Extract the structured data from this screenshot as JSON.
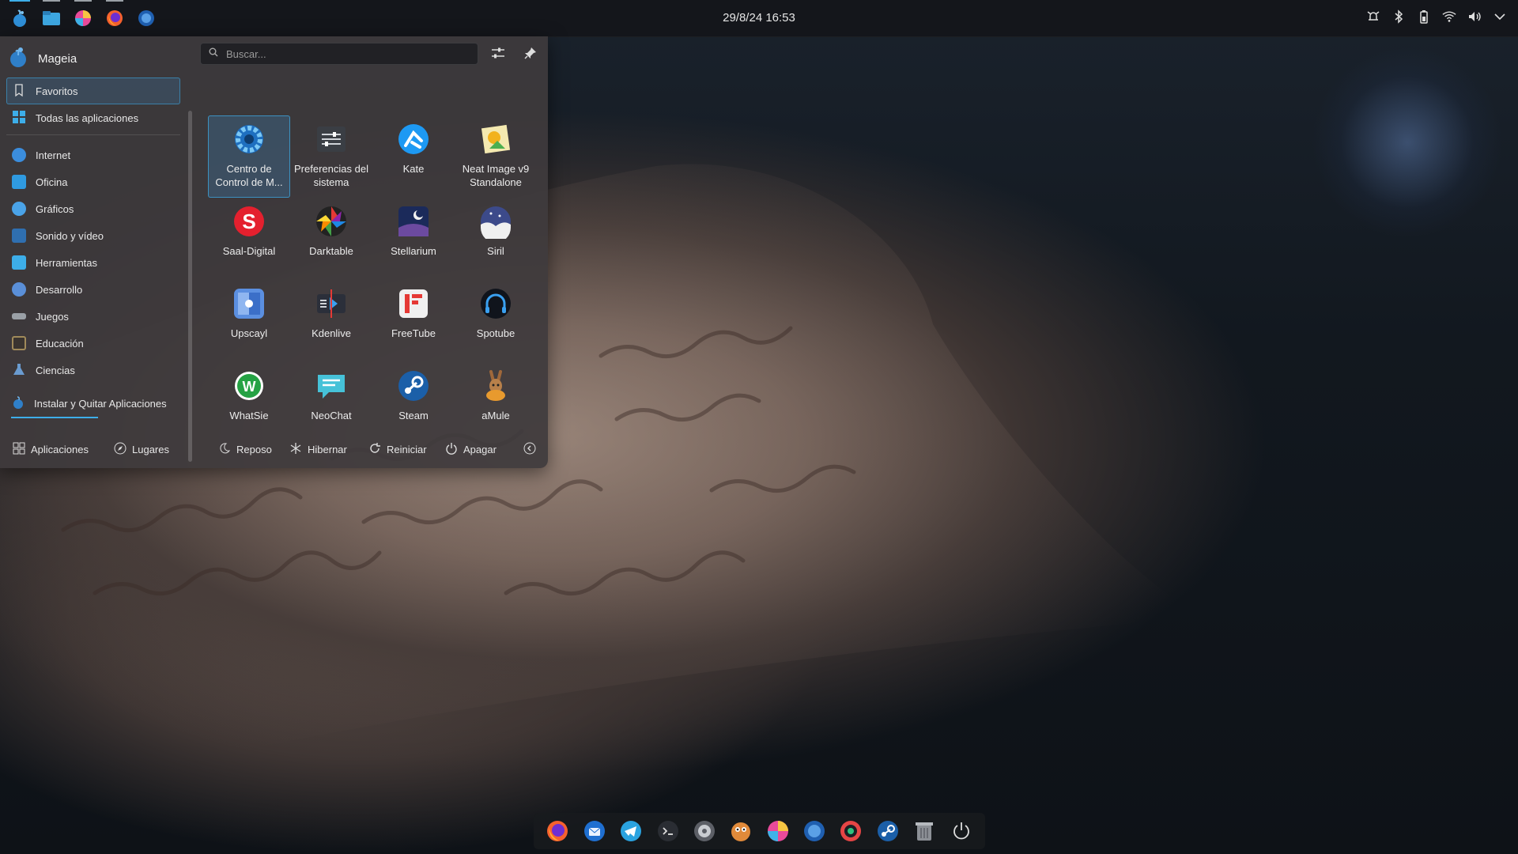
{
  "top_panel": {
    "clock": "29/8/24 16:53",
    "launchers": [
      {
        "icon": "mageia-menu-icon"
      },
      {
        "icon": "file-manager-icon"
      },
      {
        "icon": "krita-icon"
      },
      {
        "icon": "firefox-icon"
      },
      {
        "icon": "blue-globe-icon"
      }
    ],
    "tray": [
      "notifications-icon",
      "bluetooth-icon",
      "battery-icon",
      "wifi-icon",
      "volume-icon",
      "chevron-down-icon"
    ]
  },
  "menu": {
    "user": "Mageia",
    "search": {
      "placeholder": "Buscar..."
    },
    "categories": [
      {
        "label": "Favoritos",
        "color": "#3d3d44"
      },
      {
        "label": "Todas las aplicaciones",
        "color": "#3daee9"
      }
    ],
    "sections": [
      {
        "label": "Internet",
        "color": "#3b8ddd"
      },
      {
        "label": "Oficina",
        "color": "#2f9ae0"
      },
      {
        "label": "Gráficos",
        "color": "#4aa3e8"
      },
      {
        "label": "Sonido y vídeo",
        "color": "#2f6fb0"
      },
      {
        "label": "Herramientas",
        "color": "#3daee9"
      },
      {
        "label": "Desarrollo",
        "color": "#5a8fd8"
      },
      {
        "label": "Juegos",
        "color": "#9aa0a6"
      },
      {
        "label": "Educación",
        "color": "#a08a5a"
      },
      {
        "label": "Ciencias",
        "color": "#6a9bd0"
      }
    ],
    "installer": {
      "label": "Instalar y Quitar Aplicaciones"
    },
    "apps": [
      {
        "label": "Centro de Control de M...",
        "icon": "control-center-gear-icon"
      },
      {
        "label": "Preferencias del sistema",
        "icon": "system-settings-icon"
      },
      {
        "label": "Kate",
        "icon": "kate-icon"
      },
      {
        "label": "Neat Image v9 Standalone",
        "icon": "neat-image-icon"
      },
      {
        "label": "Saal-Digital",
        "icon": "saal-digital-icon"
      },
      {
        "label": "Darktable",
        "icon": "darktable-aperture-icon"
      },
      {
        "label": "Stellarium",
        "icon": "stellarium-icon"
      },
      {
        "label": "Siril",
        "icon": "siril-icon"
      },
      {
        "label": "Upscayl",
        "icon": "upscayl-icon"
      },
      {
        "label": "Kdenlive",
        "icon": "kdenlive-icon"
      },
      {
        "label": "FreeTube",
        "icon": "freetube-icon"
      },
      {
        "label": "Spotube",
        "icon": "spotube-headphones-icon"
      },
      {
        "label": "WhatSie",
        "icon": "whatsie-icon"
      },
      {
        "label": "NeoChat",
        "icon": "neochat-icon"
      },
      {
        "label": "Steam",
        "icon": "steam-icon"
      },
      {
        "label": "aMule",
        "icon": "amule-mule-icon"
      }
    ],
    "footer": {
      "applications": "Aplicaciones",
      "places": "Lugares",
      "sleep": "Reposo",
      "hibernate": "Hibernar",
      "restart": "Reiniciar",
      "shutdown": "Apagar"
    }
  },
  "dock": [
    "firefox-icon",
    "thunderbird-icon",
    "telegram-icon",
    "terminal-icon",
    "aperture-icon",
    "gimp-icon",
    "krita-icon",
    "globe-icon",
    "record-icon",
    "steam-icon",
    "trash-icon",
    "power-icon"
  ]
}
